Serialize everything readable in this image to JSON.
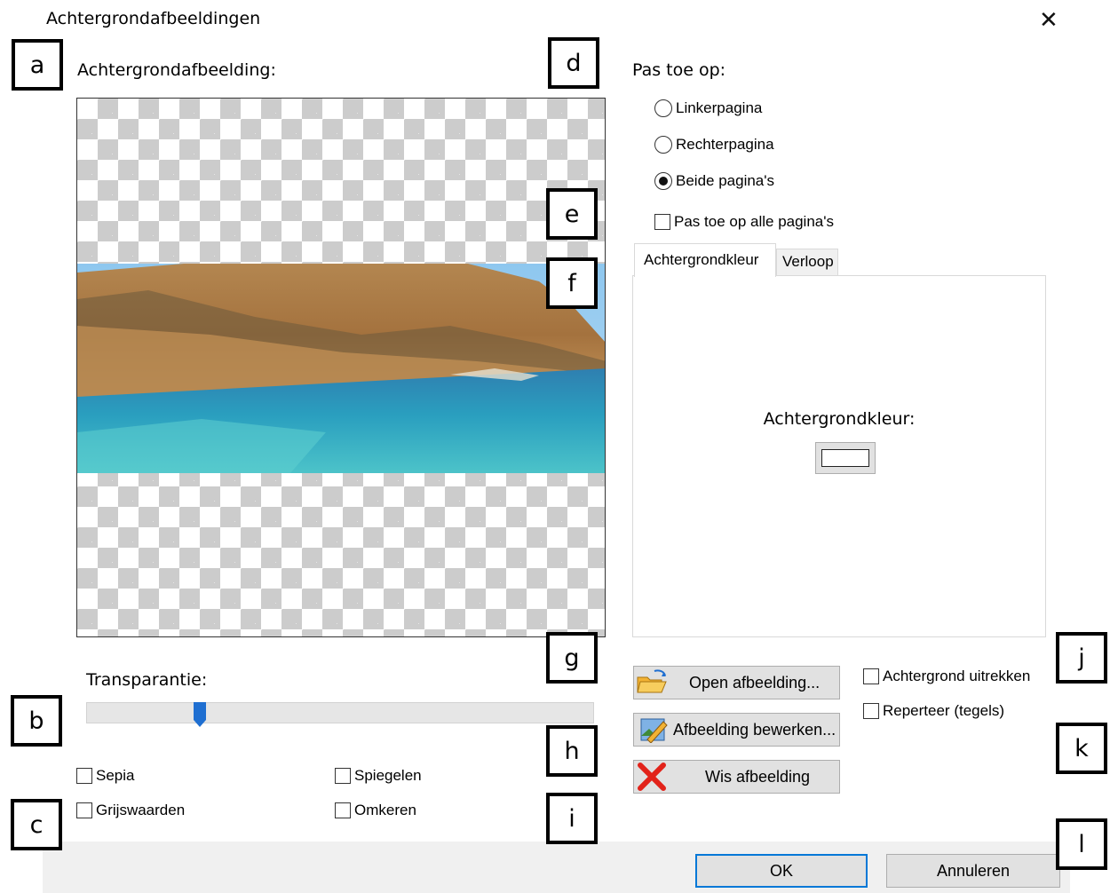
{
  "window": {
    "title": "Achtergrondafbeeldingen",
    "close_glyph": "✕"
  },
  "preview": {
    "label": "Achtergrondafbeelding:"
  },
  "transparency": {
    "label": "Transparantie:",
    "level": 0.2
  },
  "effects": {
    "sepia": {
      "label": "Sepia",
      "checked": false
    },
    "mirror": {
      "label": "Spiegelen",
      "checked": false
    },
    "grayscale": {
      "label": "Grijswaarden",
      "checked": false
    },
    "invert": {
      "label": "Omkeren",
      "checked": false
    }
  },
  "apply": {
    "label": "Pas toe op:",
    "options": [
      {
        "label": "Linkerpagina",
        "selected": false
      },
      {
        "label": "Rechterpagina",
        "selected": false
      },
      {
        "label": "Beide pagina's",
        "selected": true
      }
    ],
    "all_pages": {
      "label": "Pas toe op alle pagina's",
      "checked": false
    }
  },
  "tabs": [
    {
      "label": "Achtergrondkleur",
      "active": true
    },
    {
      "label": "Verloop",
      "active": false
    }
  ],
  "background_color": {
    "label": "Achtergrondkleur:",
    "value": "#ffffff"
  },
  "buttons": {
    "open": "Open afbeelding...",
    "edit": "Afbeelding bewerken...",
    "clear": "Wis afbeelding"
  },
  "options": {
    "stretch": {
      "label": "Achtergrond uitrekken",
      "checked": false
    },
    "tile": {
      "label": "Reperteer (tegels)",
      "checked": false
    }
  },
  "footer": {
    "ok": "OK",
    "cancel": "Annuleren"
  },
  "markers": [
    "a",
    "b",
    "c",
    "d",
    "e",
    "f",
    "g",
    "h",
    "i",
    "j",
    "k",
    "l"
  ],
  "colors": {
    "ok_border": "#0078d7",
    "slider_thumb": "#1f6fd1",
    "clear_icon": "#e2231a",
    "folder_icon": "#f2b233"
  }
}
